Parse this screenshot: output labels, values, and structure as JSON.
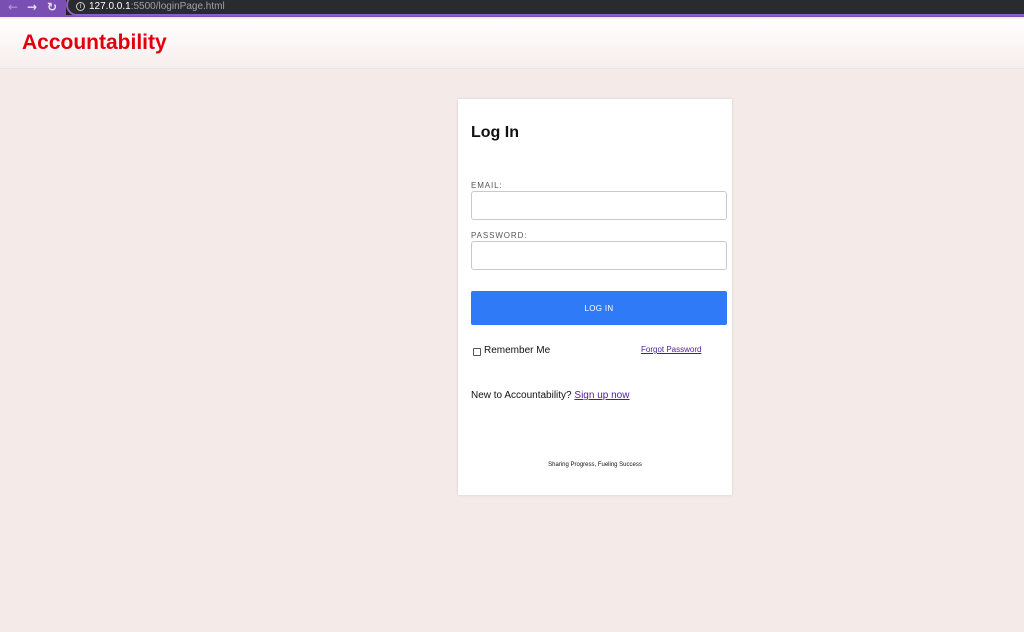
{
  "browser": {
    "url_host": "127.0.0.1",
    "url_rest": ":5500/loginPage.html"
  },
  "header": {
    "brand": "Accountability"
  },
  "login": {
    "title": "Log In",
    "email_label": "EMAIL:",
    "email_value": "",
    "password_label": "PASSWORD:",
    "password_value": "",
    "login_button": "LOG IN",
    "remember_label": "Remember Me",
    "forgot_link": "Forgot Password",
    "signup_prompt": "New to Accountability?",
    "signup_link": "Sign up now",
    "tagline": "Sharing Progress, Fueling Success"
  },
  "colors": {
    "brand": "#e0000c",
    "button": "#2f7af6",
    "link": "#4b1aa0",
    "page_background": "#f4ebe9",
    "browser_accent": "#7a4fb3"
  },
  "icons": {
    "back": "arrow-left-icon",
    "forward": "arrow-right-icon",
    "reload": "reload-icon",
    "site_info": "info-icon"
  }
}
